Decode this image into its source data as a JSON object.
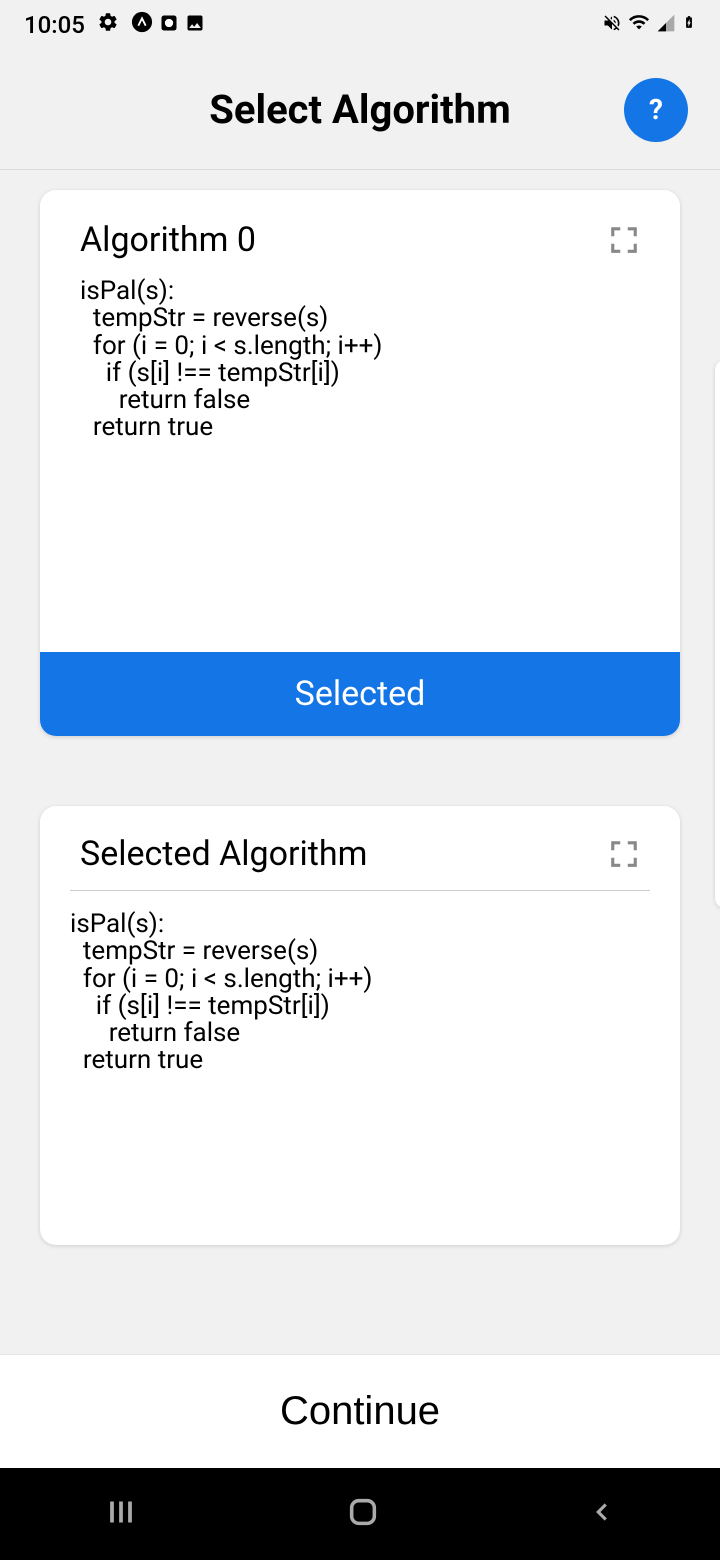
{
  "status": {
    "time": "10:05"
  },
  "header": {
    "title": "Select Algorithm",
    "help": "?"
  },
  "card0": {
    "title": "Algorithm 0",
    "code": "isPal(s):\n  tempStr = reverse(s)\n  for (i = 0; i < s.length; i++)\n    if (s[i] !== tempStr[i])\n      return false\n  return true",
    "banner": "Selected"
  },
  "card1": {
    "title": "Selected Algorithm",
    "code": "isPal(s):\n  tempStr = reverse(s)\n  for (i = 0; i < s.length; i++)\n    if (s[i] !== tempStr[i])\n      return false\n  return true"
  },
  "footer": {
    "continue": "Continue"
  }
}
